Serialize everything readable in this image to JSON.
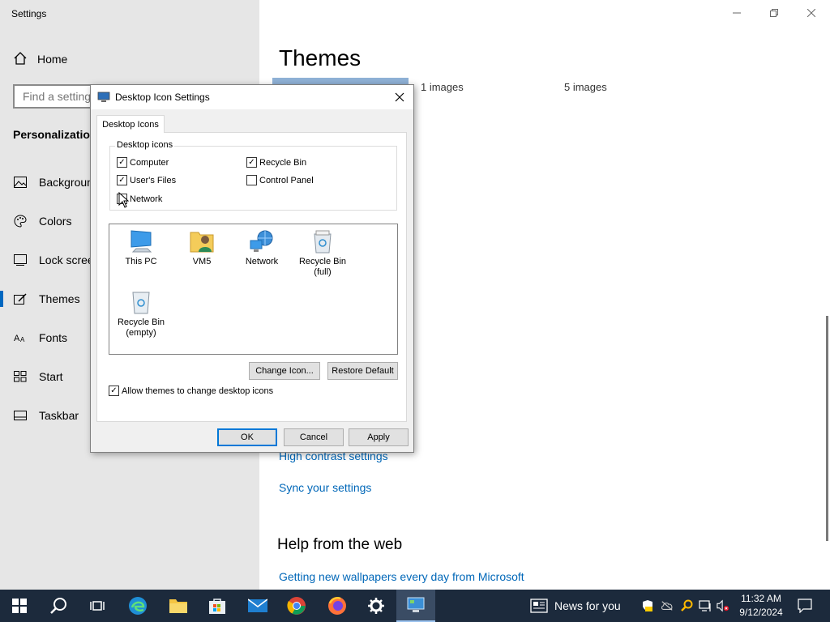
{
  "settings": {
    "app_title": "Settings",
    "home_label": "Home",
    "search_placeholder": "Find a setting",
    "section_label": "Personalization",
    "nav_items": [
      {
        "label": "Background",
        "icon": "picture-icon"
      },
      {
        "label": "Colors",
        "icon": "palette-icon"
      },
      {
        "label": "Lock screen",
        "icon": "lock-screen-icon"
      },
      {
        "label": "Themes",
        "icon": "themes-icon",
        "active": true
      },
      {
        "label": "Fonts",
        "icon": "fonts-icon"
      },
      {
        "label": "Start",
        "icon": "start-icon"
      },
      {
        "label": "Taskbar",
        "icon": "taskbar-icon"
      }
    ],
    "page_title": "Themes",
    "theme_1_count": "1 images",
    "theme_2_count": "5 images",
    "high_contrast_link": "High contrast settings",
    "sync_link": "Sync your settings",
    "help_title": "Help from the web",
    "help_link": "Getting new wallpapers every day from Microsoft"
  },
  "dialog": {
    "title": "Desktop Icon Settings",
    "tab": "Desktop Icons",
    "group_label": "Desktop icons",
    "checkboxes": [
      {
        "label": "Computer",
        "checked": true
      },
      {
        "label": "Recycle Bin",
        "checked": true
      },
      {
        "label": "User's Files",
        "checked": true
      },
      {
        "label": "Control Panel",
        "checked": false
      },
      {
        "label": "Network",
        "checked": false
      }
    ],
    "icons": [
      {
        "label": "This PC",
        "icon": "computer-icon"
      },
      {
        "label": "VM5",
        "icon": "user-folder-icon"
      },
      {
        "label": "Network",
        "icon": "network-icon"
      },
      {
        "label": "Recycle Bin\n(full)",
        "icon": "recycle-bin-full-icon"
      },
      {
        "label": "Recycle Bin\n(empty)",
        "icon": "recycle-bin-empty-icon"
      }
    ],
    "change_icon_label": "Change Icon...",
    "restore_default_label": "Restore Default",
    "allow_themes_label": "Allow themes to change desktop icons",
    "allow_themes_checked": true,
    "ok_label": "OK",
    "cancel_label": "Cancel",
    "apply_label": "Apply"
  },
  "taskbar": {
    "news_label": "News for you",
    "time": "11:32 AM",
    "date": "9/12/2024"
  },
  "colors": {
    "accent": "#0067c0",
    "link": "#0067b8",
    "taskbar": "#1c2a3c"
  }
}
